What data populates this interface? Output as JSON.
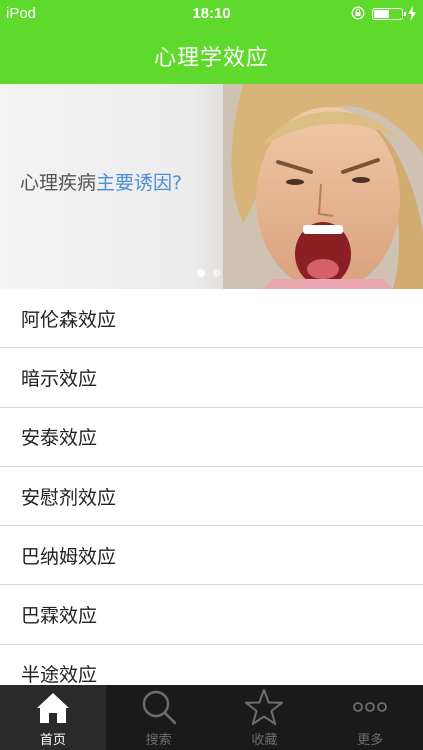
{
  "status_bar": {
    "carrier": "iPod",
    "time": "18:10"
  },
  "nav": {
    "title": "心理学效应"
  },
  "banner": {
    "caption_prefix": "心理疾病",
    "caption_highlight": "主要诱因?",
    "highlight_color": "#4a90d9",
    "page_count": 2,
    "active_page": 1
  },
  "list": {
    "items": [
      "阿伦森效应",
      "暗示效应",
      "安泰效应",
      "安慰剂效应",
      "巴纳姆效应",
      "巴霖效应",
      "半途效应"
    ]
  },
  "tabs": [
    {
      "label": "首页",
      "icon": "home-icon",
      "active": true
    },
    {
      "label": "搜索",
      "icon": "search-icon",
      "active": false
    },
    {
      "label": "收藏",
      "icon": "star-icon",
      "active": false
    },
    {
      "label": "更多",
      "icon": "more-icon",
      "active": false
    }
  ],
  "colors": {
    "accent": "#5fd92b",
    "tabbar": "#1a1a1a"
  }
}
